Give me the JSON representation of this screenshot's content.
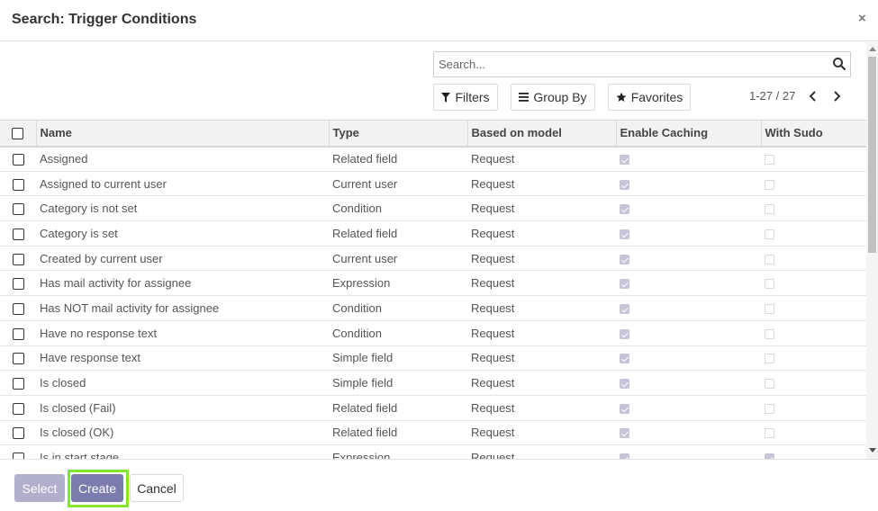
{
  "dialog": {
    "title": "Search: Trigger Conditions",
    "close_label": "×"
  },
  "search": {
    "placeholder": "Search...",
    "value": ""
  },
  "filters": {
    "filters_label": "Filters",
    "group_by_label": "Group By",
    "favorites_label": "Favorites"
  },
  "pager": {
    "text": "1-27 / 27"
  },
  "table": {
    "columns": [
      "Name",
      "Type",
      "Based on model",
      "Enable Caching",
      "With Sudo"
    ],
    "rows": [
      {
        "name": "Assigned",
        "type": "Related field",
        "model": "Request",
        "caching": true,
        "sudo": false
      },
      {
        "name": "Assigned to current user",
        "type": "Current user",
        "model": "Request",
        "caching": true,
        "sudo": false
      },
      {
        "name": "Category is not set",
        "type": "Condition",
        "model": "Request",
        "caching": true,
        "sudo": false
      },
      {
        "name": "Category is set",
        "type": "Related field",
        "model": "Request",
        "caching": true,
        "sudo": false
      },
      {
        "name": "Created by current user",
        "type": "Current user",
        "model": "Request",
        "caching": true,
        "sudo": false
      },
      {
        "name": "Has mail activity for assignee",
        "type": "Expression",
        "model": "Request",
        "caching": true,
        "sudo": false
      },
      {
        "name": "Has NOT mail activity for assignee",
        "type": "Condition",
        "model": "Request",
        "caching": true,
        "sudo": false
      },
      {
        "name": "Have no response text",
        "type": "Condition",
        "model": "Request",
        "caching": true,
        "sudo": false
      },
      {
        "name": "Have response text",
        "type": "Simple field",
        "model": "Request",
        "caching": true,
        "sudo": false
      },
      {
        "name": "Is closed",
        "type": "Simple field",
        "model": "Request",
        "caching": true,
        "sudo": false
      },
      {
        "name": "Is closed (Fail)",
        "type": "Related field",
        "model": "Request",
        "caching": true,
        "sudo": false
      },
      {
        "name": "Is closed (OK)",
        "type": "Related field",
        "model": "Request",
        "caching": true,
        "sudo": false
      },
      {
        "name": "Is in start stage",
        "type": "Expression",
        "model": "Request",
        "caching": true,
        "sudo": true
      }
    ]
  },
  "footer": {
    "select_label": "Select",
    "create_label": "Create",
    "cancel_label": "Cancel"
  },
  "colors": {
    "primary": "#7c7bad",
    "primary_disabled": "#b1afcb",
    "highlight_ring": "#84e62a"
  }
}
